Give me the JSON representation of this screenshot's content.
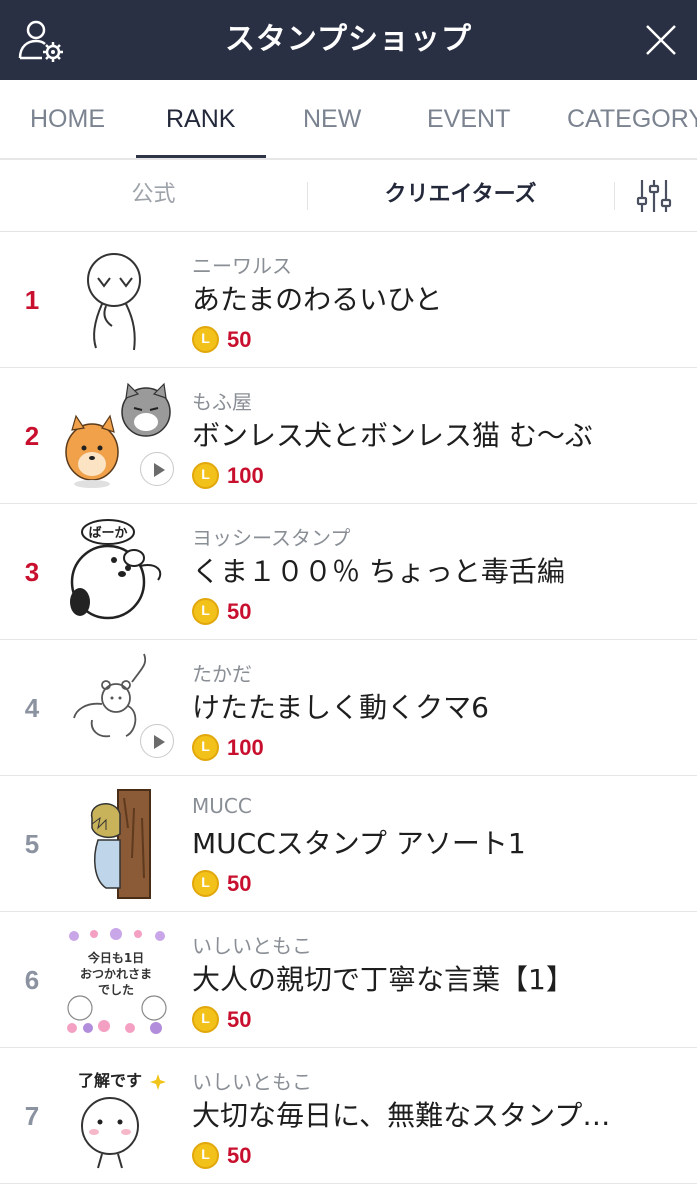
{
  "header": {
    "title": "スタンプショップ",
    "left_icon": "user-settings-icon",
    "right_icon": "close-icon"
  },
  "tabs": [
    {
      "label": "HOME",
      "active": false
    },
    {
      "label": "RANK",
      "active": true
    },
    {
      "label": "NEW",
      "active": false
    },
    {
      "label": "EVENT",
      "active": false
    },
    {
      "label": "CATEGORY",
      "active": false
    }
  ],
  "subfilter": {
    "official": "公式",
    "creators": "クリエイターズ",
    "selected": "creators",
    "filter_icon": "sliders-icon"
  },
  "colors": {
    "header_bg": "#2a3044",
    "rank_top": "#c8102e",
    "rank_other": "#8c93a0",
    "price": "#c8102e",
    "coin": "#f3c21a"
  },
  "items": [
    {
      "rank": "1",
      "author": "ニーワルス",
      "name": "あたまのわるいひと",
      "price": "50",
      "has_play": false,
      "thumb": "stick-figure-sticker"
    },
    {
      "rank": "2",
      "author": "もふ屋",
      "name": "ボンレス犬とボンレス猫 む〜ぶ",
      "price": "100",
      "has_play": true,
      "thumb": "dog-and-cat-sticker"
    },
    {
      "rank": "3",
      "author": "ヨッシースタンプ",
      "name": "くま１００％ ちょっと毒舌編",
      "price": "50",
      "has_play": false,
      "thumb": "bear-baka-sticker",
      "thumb_text": "ばーか"
    },
    {
      "rank": "4",
      "author": "たかだ",
      "name": "けたたましく動くクマ6",
      "price": "100",
      "has_play": true,
      "thumb": "line-bear-sticker"
    },
    {
      "rank": "5",
      "author": "MUCC",
      "name": "MUCCスタンプ アソート1",
      "price": "50",
      "has_play": false,
      "thumb": "tree-person-sticker"
    },
    {
      "rank": "6",
      "author": "いしいともこ",
      "name": "大人の親切で丁寧な言葉【1】",
      "price": "50",
      "has_play": false,
      "thumb": "flower-bears-sticker",
      "thumb_text": [
        "今日も1日",
        "おつかれさま",
        "でした"
      ]
    },
    {
      "rank": "7",
      "author": "いしいともこ",
      "name": "大切な毎日に、無難なスタンプ…",
      "price": "50",
      "has_play": false,
      "thumb": "ryokai-sticker",
      "thumb_text": "了解です"
    }
  ],
  "coin_letter": "L"
}
